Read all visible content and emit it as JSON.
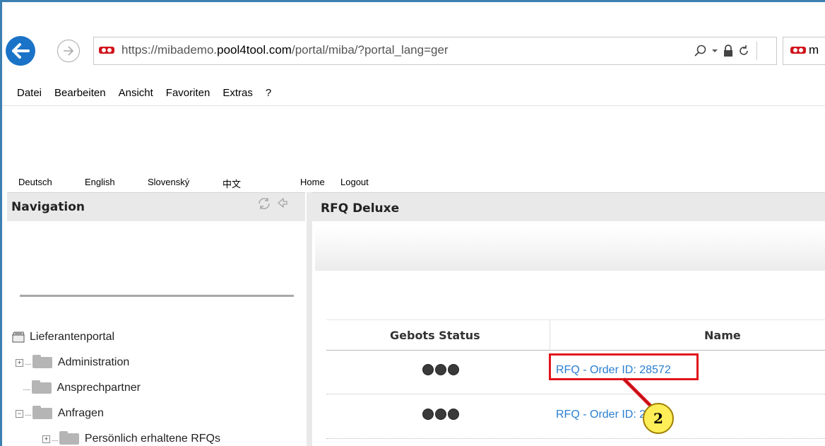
{
  "browser": {
    "url_prefix": "https://mibademo.",
    "url_domain": "pool4tool.com",
    "url_suffix": "/portal/miba/?portal_lang=ger",
    "tab_text": "m",
    "back_icon": "arrow-left-icon",
    "forward_icon": "arrow-right-icon"
  },
  "menu": {
    "items": [
      "Datei",
      "Bearbeiten",
      "Ansicht",
      "Favoriten",
      "Extras",
      "?"
    ]
  },
  "portal_links": {
    "languages": [
      "Deutsch",
      "English",
      "Slovenský",
      "中文"
    ],
    "home": "Home",
    "logout": "Logout"
  },
  "navigation": {
    "title": "Navigation",
    "root": "Lieferantenportal",
    "items": [
      "Administration",
      "Ansprechpartner",
      "Anfragen",
      "Persönlich erhaltene RFQs"
    ]
  },
  "content": {
    "title": "RFQ Deluxe",
    "columns": [
      "Gebots Status",
      "Name"
    ],
    "rows": [
      {
        "name": "RFQ - Order ID: 28572"
      },
      {
        "name": "RFQ - Order ID: 28571"
      }
    ]
  },
  "annotation": {
    "badge": "2",
    "color": "#e0151c"
  }
}
